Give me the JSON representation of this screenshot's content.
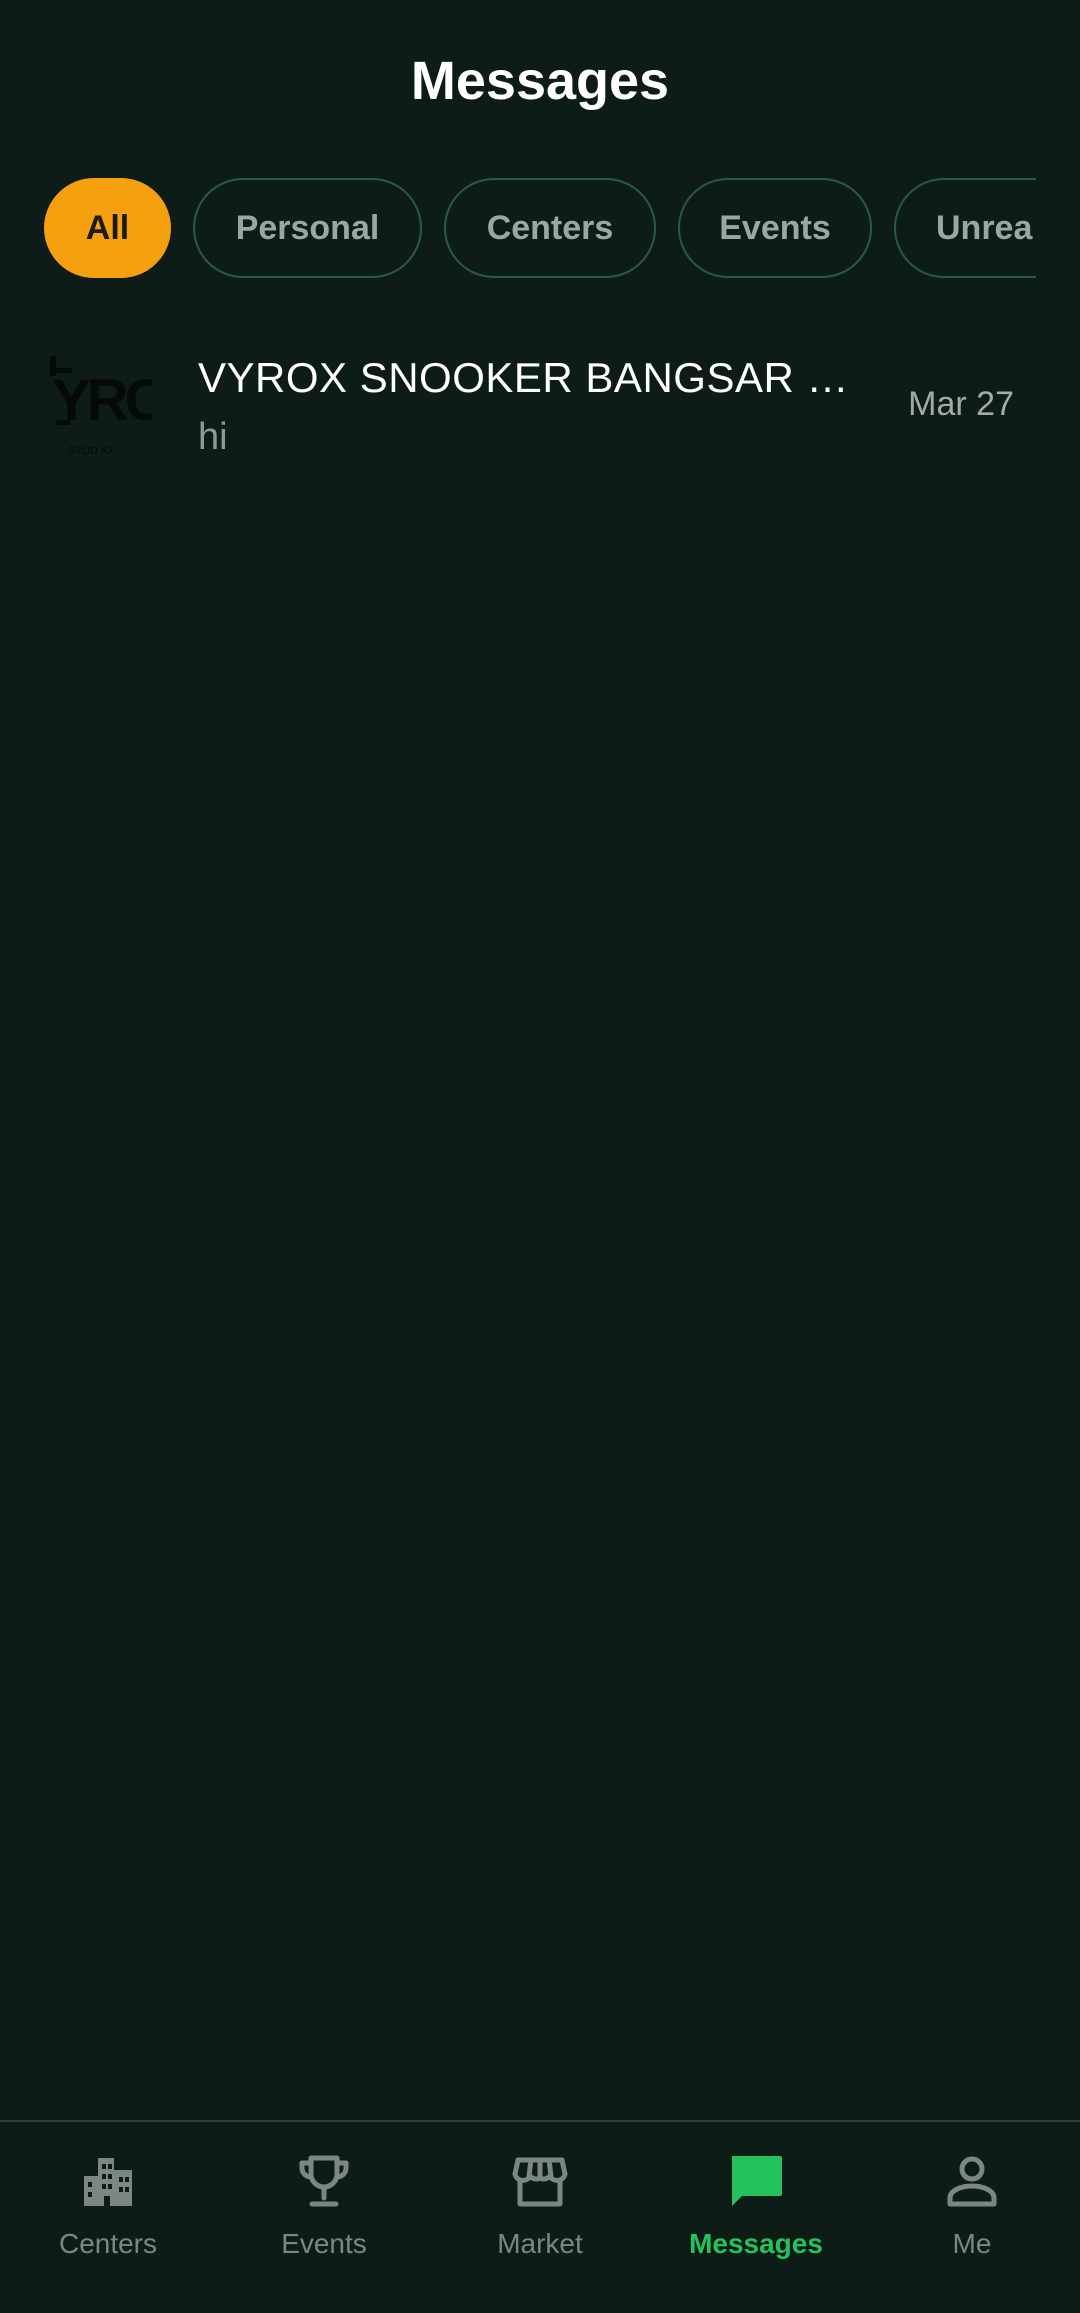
{
  "header": {
    "title": "Messages"
  },
  "filters": {
    "items": [
      {
        "label": "All",
        "active": true
      },
      {
        "label": "Personal",
        "active": false
      },
      {
        "label": "Centers",
        "active": false
      },
      {
        "label": "Events",
        "active": false
      },
      {
        "label": "Unrea",
        "active": false
      }
    ]
  },
  "conversations": [
    {
      "name": "VYROX SNOOKER BANGSAR C…",
      "preview": "hi",
      "date": "Mar 27",
      "avatar_text": "YRC"
    }
  ],
  "bottom_nav": {
    "items": [
      {
        "label": "Centers",
        "icon": "building-icon",
        "active": false
      },
      {
        "label": "Events",
        "icon": "trophy-icon",
        "active": false
      },
      {
        "label": "Market",
        "icon": "store-icon",
        "active": false
      },
      {
        "label": "Messages",
        "icon": "chat-icon",
        "active": true
      },
      {
        "label": "Me",
        "icon": "person-icon",
        "active": false
      }
    ]
  },
  "colors": {
    "background": "#0e1c17",
    "accent": "#f5a00f",
    "active_nav": "#22c25c",
    "chip_border": "#2b5a42"
  }
}
